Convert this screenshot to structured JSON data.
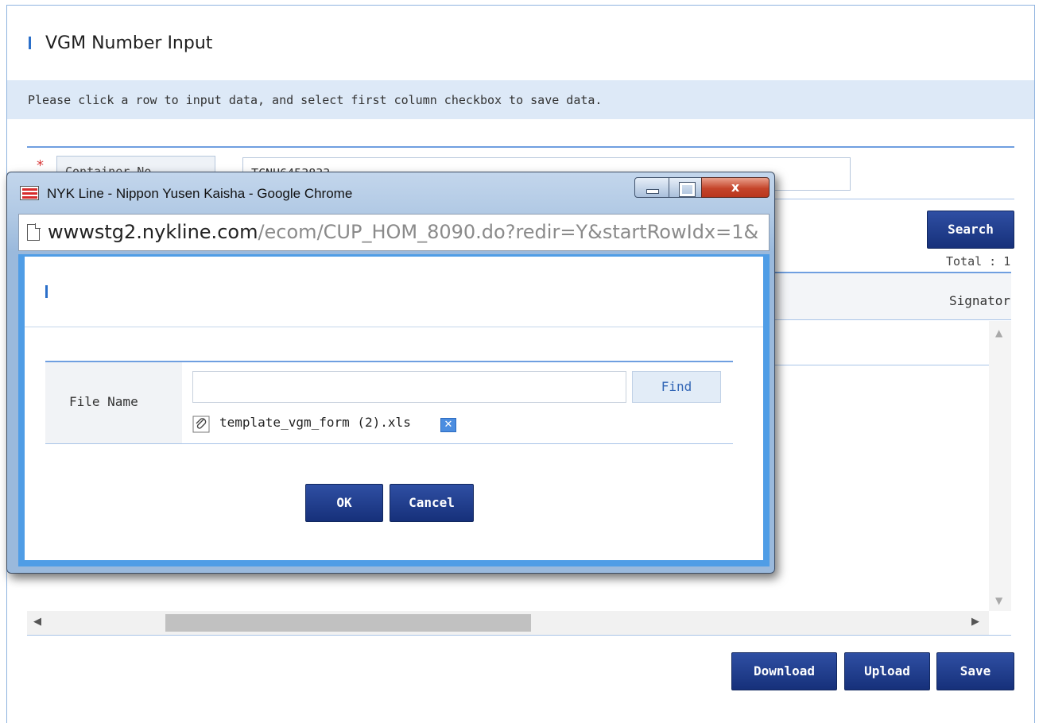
{
  "page": {
    "title": "VGM Number Input",
    "notice": "Please click a row to input data, and select first column checkbox to save data.",
    "filter": {
      "required_mark": "*",
      "select_value": "Container No",
      "input_value": "TCNU6453833"
    },
    "search_label": "Search",
    "total_text": "Total : 1",
    "grid": {
      "visible_header": "Signator"
    },
    "buttons": {
      "download": "Download",
      "upload": "Upload",
      "save": "Save"
    }
  },
  "popup": {
    "window_title": "NYK Line - Nippon Yusen Kaisha - Google Chrome",
    "url_host": "wwwstg2.nykline.com",
    "url_path": "/ecom/CUP_HOM_8090.do?redir=Y&startRowIdx=1&",
    "close_glyph": "x",
    "form": {
      "label": "File Name",
      "file_value": "",
      "find_label": "Find",
      "attached_file": "template_vgm_form (2).xls",
      "remove_glyph": "✕"
    },
    "ok_label": "OK",
    "cancel_label": "Cancel"
  },
  "icons": {
    "window_app": "nyk-flag-icon",
    "url": "page-document-icon",
    "attachment": "paperclip-icon",
    "remove": "close-icon"
  },
  "colors": {
    "accent": "#2b6fc9",
    "button": "#1d3a8a",
    "notice_bg": "#dde9f7",
    "popup_border": "#4f9de6"
  }
}
